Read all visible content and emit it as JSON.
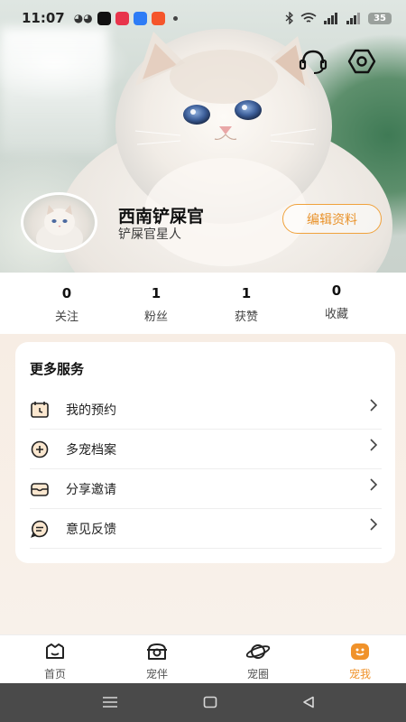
{
  "status_bar": {
    "time": "11:07",
    "battery": "35"
  },
  "profile": {
    "username": "西南铲屎官",
    "tag": "铲屎官星人",
    "edit_button": "编辑资料"
  },
  "stats": [
    {
      "value": "0",
      "label": "关注"
    },
    {
      "value": "1",
      "label": "粉丝"
    },
    {
      "value": "1",
      "label": "获赞"
    },
    {
      "value": "0",
      "label": "收藏"
    }
  ],
  "services": {
    "title": "更多服务",
    "items": [
      {
        "label": "我的预约",
        "icon": "calendar-icon"
      },
      {
        "label": "多宠档案",
        "icon": "plus-circle-icon"
      },
      {
        "label": "分享邀请",
        "icon": "share-tray-icon"
      },
      {
        "label": "意见反馈",
        "icon": "feedback-icon"
      }
    ]
  },
  "tabs": [
    {
      "label": "首页",
      "icon": "home-icon",
      "active": false
    },
    {
      "label": "宠伴",
      "icon": "pet-companion-icon",
      "active": false
    },
    {
      "label": "宠圈",
      "icon": "planet-icon",
      "active": false
    },
    {
      "label": "宠我",
      "icon": "me-face-icon",
      "active": true
    }
  ],
  "colors": {
    "accent": "#f0922a",
    "edit_border": "#f0a23c",
    "nav_bar": "#4a4a4a"
  }
}
